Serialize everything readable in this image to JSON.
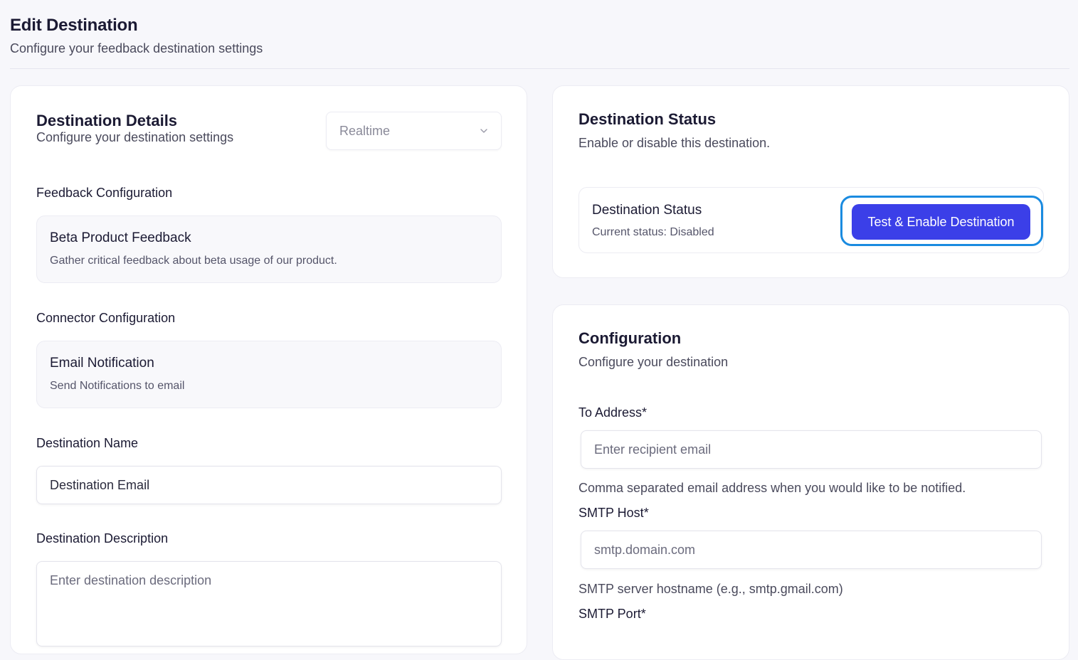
{
  "header": {
    "title": "Edit Destination",
    "subtitle": "Configure your feedback destination settings"
  },
  "details": {
    "title": "Destination Details",
    "subtitle": "Configure your destination settings",
    "mode_select": {
      "selected": "Realtime"
    },
    "feedback_section_label": "Feedback Configuration",
    "feedback": {
      "title": "Beta Product Feedback",
      "description": "Gather critical feedback about beta usage of our product."
    },
    "connector_section_label": "Connector Configuration",
    "connector": {
      "title": "Email Notification",
      "description": "Send Notifications to email"
    },
    "name_label": "Destination Name",
    "name_value": "Destination Email",
    "description_label": "Destination Description",
    "description_placeholder": "Enter destination description"
  },
  "status": {
    "title": "Destination Status",
    "subtitle": "Enable or disable this destination.",
    "box_title": "Destination Status",
    "current": "Current status: Disabled",
    "button_label": "Test & Enable Destination",
    "highlight_color": "#1a8be0",
    "button_color": "#3b3fe8"
  },
  "config": {
    "title": "Configuration",
    "subtitle": "Configure your destination",
    "to_label": "To Address*",
    "to_placeholder": "Enter recipient email",
    "to_help": "Comma separated email address when you would like to be notified.",
    "host_label": "SMTP Host*",
    "host_placeholder": "smtp.domain.com",
    "host_help": "SMTP server hostname (e.g., smtp.gmail.com)",
    "port_label": "SMTP Port*"
  }
}
